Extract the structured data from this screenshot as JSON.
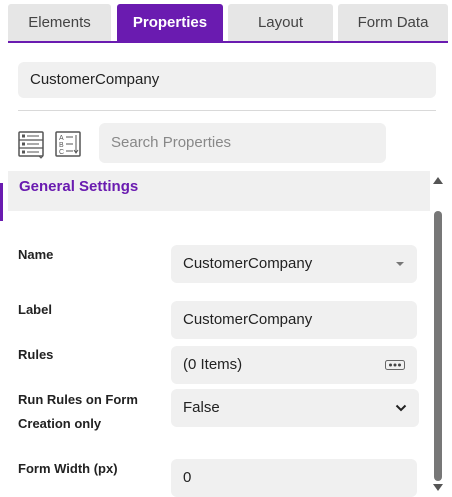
{
  "tabs": [
    {
      "label": "Elements",
      "active": false
    },
    {
      "label": "Properties",
      "active": true
    },
    {
      "label": "Layout",
      "active": false
    },
    {
      "label": "Form Data",
      "active": false
    }
  ],
  "component_name": "CustomerCompany",
  "search": {
    "placeholder": "Search Properties"
  },
  "section": {
    "title": "General Settings"
  },
  "properties": {
    "name": {
      "label": "Name",
      "value": "CustomerCompany"
    },
    "label": {
      "label": "Label",
      "value": "CustomerCompany"
    },
    "rules": {
      "label": "Rules",
      "value": "(0 Items)"
    },
    "run_rules": {
      "label_line1": "Run Rules on Form",
      "label_line2": "Creation only",
      "value": "False"
    },
    "form_width": {
      "label": "Form Width (px)",
      "value": "0"
    }
  },
  "colors": {
    "accent": "#6a1bb0",
    "field_bg": "#f0f0f0",
    "tab_bg": "#e6e6e6"
  }
}
